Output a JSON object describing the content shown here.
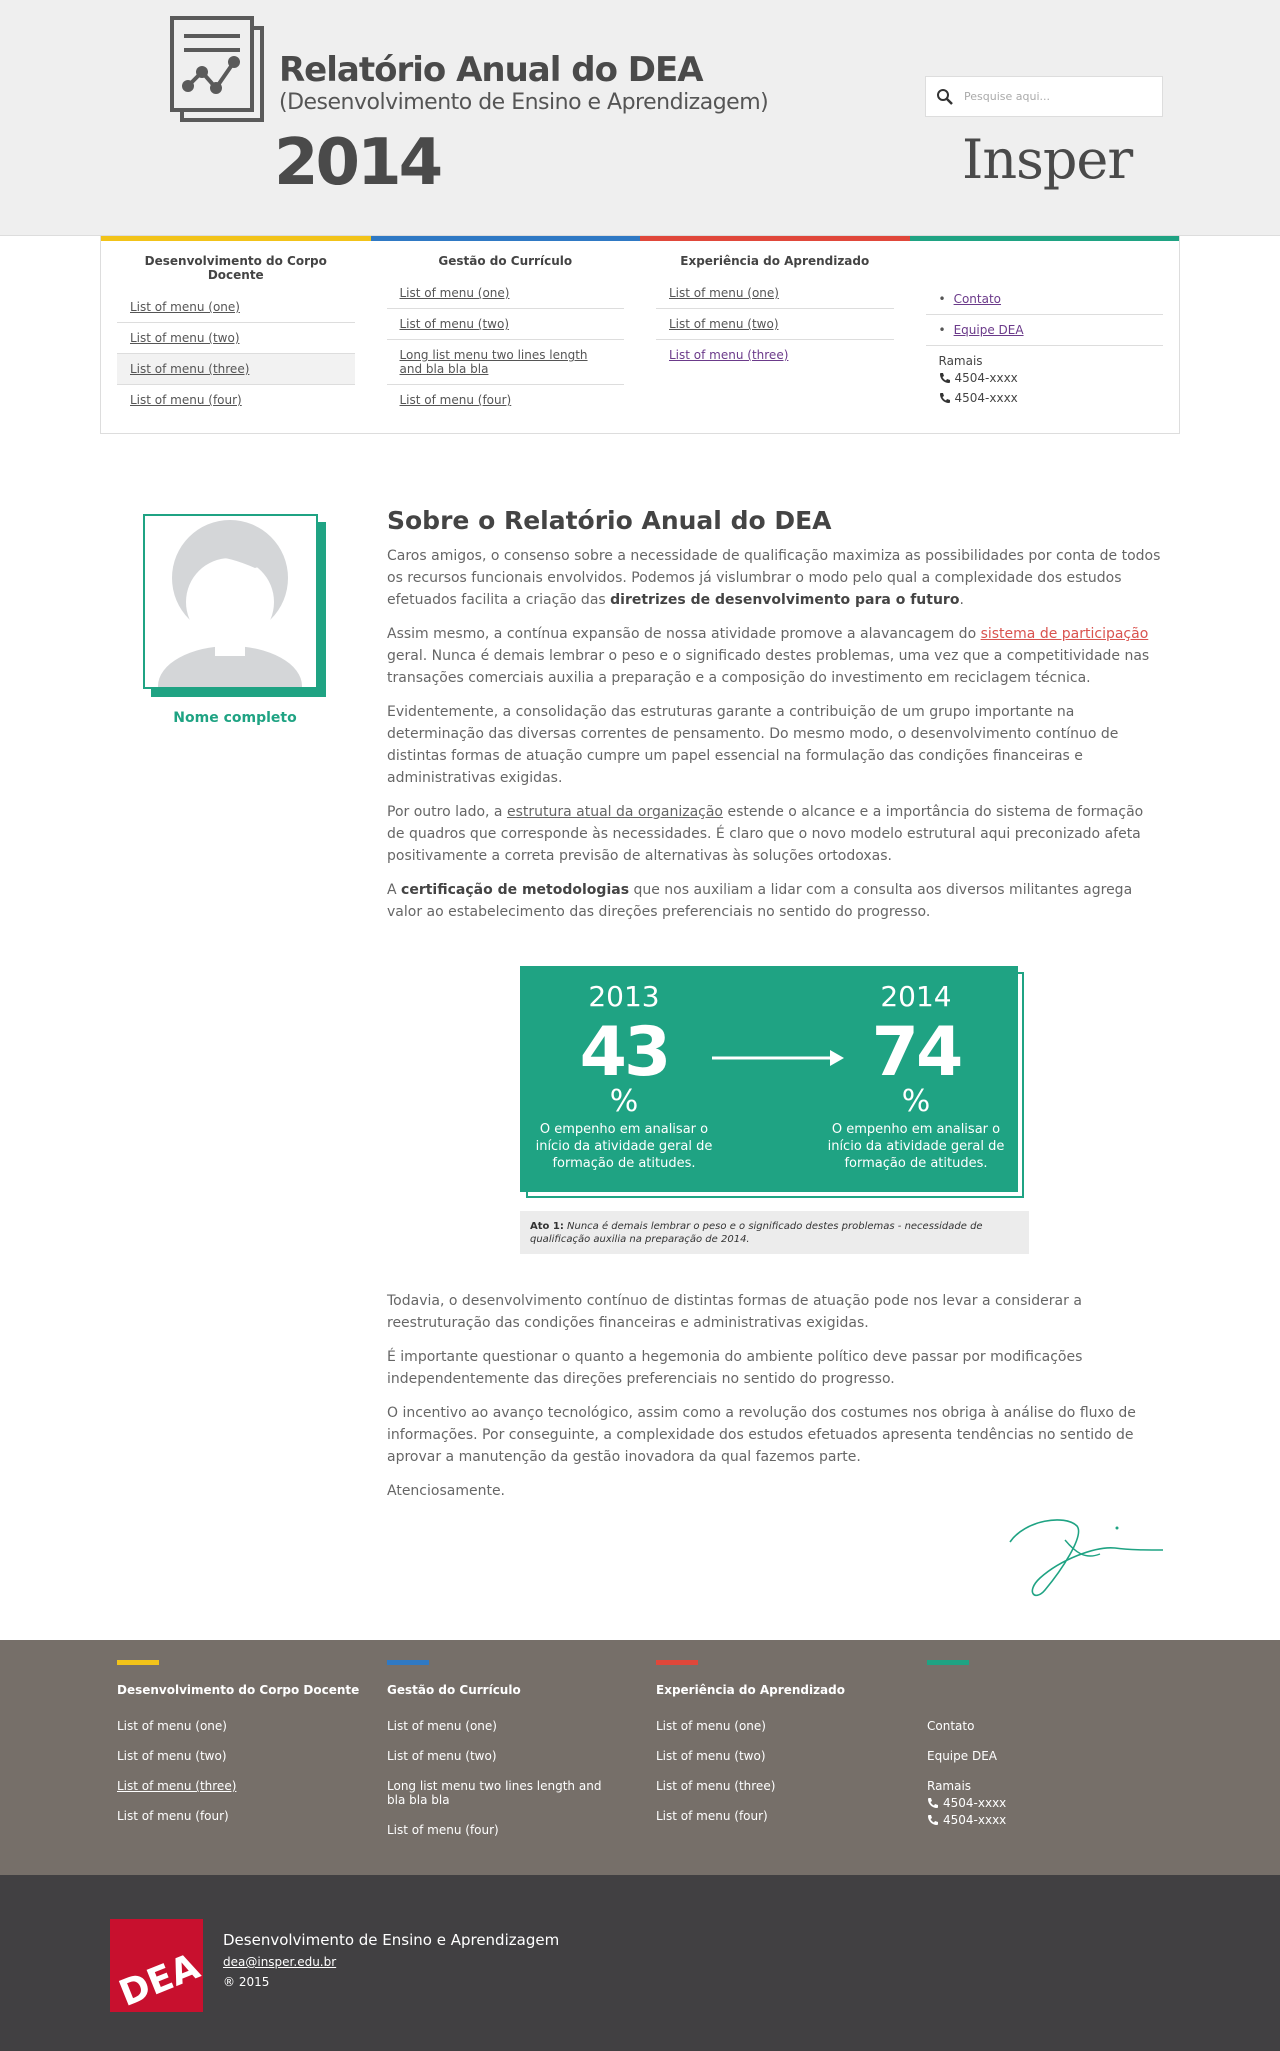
{
  "header": {
    "title": "Relatório Anual do DEA",
    "subtitle": "(Desenvolvimento de Ensino e Aprendizagem)",
    "year": "2014",
    "search_placeholder": "Pesquise aqui...",
    "brand": "Insper"
  },
  "menu": {
    "columns": [
      {
        "title": "Desenvolvimento do Corpo Docente",
        "color": "#f2c319",
        "items": [
          "List of menu (one)",
          "List of menu (two)",
          "List of menu (three)",
          "List of menu (four)"
        ]
      },
      {
        "title": "Gestão do Currículo",
        "color": "#2f79c4",
        "items": [
          "List of menu (one)",
          "List of menu (two)",
          "Long list menu two lines length and bla bla bla",
          "List of menu (four)"
        ]
      },
      {
        "title": "Experiência do Aprendizado",
        "color": "#e0473a",
        "items": [
          "List of menu (one)",
          "List of menu (two)",
          "List of menu (three)"
        ]
      }
    ],
    "contact": {
      "color": "#1fa383",
      "links": [
        "Contato",
        "Equipe DEA"
      ],
      "ramais_label": "Ramais",
      "phones": [
        "4504-xxxx",
        "4504-xxxx"
      ]
    }
  },
  "profile": {
    "name": "Nome completo"
  },
  "article": {
    "heading": "Sobre o Relatório Anual do DEA",
    "p1_a": "Caros amigos, o consenso sobre a necessidade de qualificação maximiza as possibilidades por conta de todos os recursos funcionais envolvidos. Podemos já vislumbrar o modo pelo qual a complexidade dos estudos efetuados facilita a criação das ",
    "p1_b": "diretrizes de desenvolvimento para o futuro",
    "p1_c": ".",
    "p2_a": "Assim mesmo, a contínua expansão de nossa atividade promove a alavancagem do ",
    "p2_link": "sistema de participação",
    "p2_b": " geral. Nunca é demais lembrar o peso e o significado destes problemas, uma vez que a competitividade nas transações comerciais auxilia a preparação e a composição do investimento em reciclagem técnica.",
    "p3": "Evidentemente, a consolidação das estruturas garante a contribuição de um grupo importante na determinação das diversas correntes de pensamento. Do mesmo modo, o desenvolvimento contínuo de distintas formas de atuação cumpre um papel essencial na formulação das condições financeiras e administrativas exigidas.",
    "p4_a": "Por outro lado, a ",
    "p4_link": "estrutura atual da organização",
    "p4_b": " estende o alcance e a importância do sistema de formação de quadros que corresponde às necessidades. É claro que o novo modelo estrutural aqui preconizado afeta positivamente a correta previsão de alternativas às soluções ortodoxas.",
    "p5_a": "A ",
    "p5_b": "certificação de metodologias",
    "p5_c": " que nos auxiliam a lidar com a consulta aos diversos militantes agrega valor ao estabelecimento das direções preferenciais no sentido do progresso."
  },
  "infobox": {
    "left": {
      "year": "2013",
      "value": "43",
      "unit": "%",
      "desc": "O empenho em analisar o início da atividade geral de formação de atitudes."
    },
    "right": {
      "year": "2014",
      "value": "74",
      "unit": "%",
      "desc": "O empenho em analisar o início da atividade geral de formação de atitudes."
    },
    "caption_label": "Ato 1:",
    "caption_text": " Nunca é demais lembrar o peso e o significado destes problemas - necessidade de qualificação auxilia na preparação de 2014."
  },
  "article2": {
    "p1": "Todavia, o desenvolvimento contínuo de distintas formas de atuação pode nos levar a considerar a reestruturação das condições financeiras e administrativas exigidas.",
    "p2": "É importante questionar o quanto a hegemonia do ambiente político deve passar por modificações independentemente das direções preferenciais no sentido do progresso.",
    "p3": "O incentivo ao avanço tecnológico, assim como a revolução dos costumes nos obriga à análise do fluxo de informações. Por conseguinte, a complexidade dos estudos efetuados apresenta tendências no sentido de aprovar a manutenção da gestão inovadora da qual fazemos parte.",
    "p4": "Atenciosamente."
  },
  "footer_menu": {
    "columns": [
      {
        "title": "Desenvolvimento do Corpo Docente",
        "color": "#f2c319",
        "items": [
          "List of menu (one)",
          "List of menu (two)",
          "List of menu (three)",
          "List of menu (four)"
        ]
      },
      {
        "title": "Gestão do Currículo",
        "color": "#2f79c4",
        "items": [
          "List of menu (one)",
          "List of menu (two)",
          "Long list menu two lines length and bla bla bla",
          "List of menu (four)"
        ]
      },
      {
        "title": "Experiência do Aprendizado",
        "color": "#e0473a",
        "items": [
          "List of menu (one)",
          "List of menu (two)",
          "List of menu (three)",
          "List of menu (four)"
        ]
      }
    ],
    "contact": {
      "color": "#1fa383",
      "links": [
        "Contato",
        "Equipe DEA"
      ],
      "ramais_label": "Ramais",
      "phones": [
        "4504-xxxx",
        "4504-xxxx"
      ]
    }
  },
  "bottom": {
    "logo_text": "DEA",
    "org": "Desenvolvimento de Ensino e Aprendizagem",
    "email": "dea@insper.edu.br",
    "copyright": "® 2015"
  }
}
